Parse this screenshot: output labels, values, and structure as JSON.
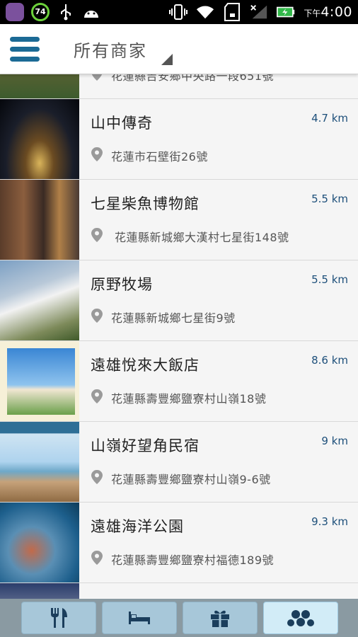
{
  "status_bar": {
    "battery_badge": "74",
    "time_prefix": "下午",
    "time": "4:00",
    "icons": [
      "viber-icon",
      "battery-saver-icon",
      "usb-icon",
      "android-icon",
      "vibrate-icon",
      "wifi-icon",
      "sd-card-icon",
      "signal-icon",
      "battery-charging-icon"
    ]
  },
  "header": {
    "title": "所有商家",
    "menu_icon": "hamburger-menu-icon",
    "accent_color": "#1b6a95"
  },
  "listings": [
    {
      "name": "",
      "distance": "",
      "address": "花蓮縣吉安鄉中央路一段651號"
    },
    {
      "name": "山中傳奇",
      "distance": "4.7 km",
      "address": "花蓮市石壁街26號"
    },
    {
      "name": "七星柴魚博物館",
      "distance": "5.5 km",
      "address": "花蓮縣新城鄉大漢村七星街148號"
    },
    {
      "name": "原野牧場",
      "distance": "5.5 km",
      "address": "花蓮縣新城鄉七星街9號"
    },
    {
      "name": "遠雄悅來大飯店",
      "distance": "8.6 km",
      "address": "花蓮縣壽豐鄉鹽寮村山嶺18號"
    },
    {
      "name": "山嶺好望角民宿",
      "distance": "9 km",
      "address": "花蓮縣壽豐鄉鹽寮村山嶺9-6號"
    },
    {
      "name": "遠雄海洋公園",
      "distance": "9.3 km",
      "address": "花蓮縣壽豐鄉鹽寮村福德189號"
    },
    {
      "name": "",
      "distance": "",
      "address": ""
    }
  ],
  "bottom_tabs": [
    {
      "icon": "restaurant-icon",
      "active": false
    },
    {
      "icon": "hotel-bed-icon",
      "active": false
    },
    {
      "icon": "gift-icon",
      "active": false
    },
    {
      "icon": "more-dots-icon",
      "active": true
    }
  ]
}
